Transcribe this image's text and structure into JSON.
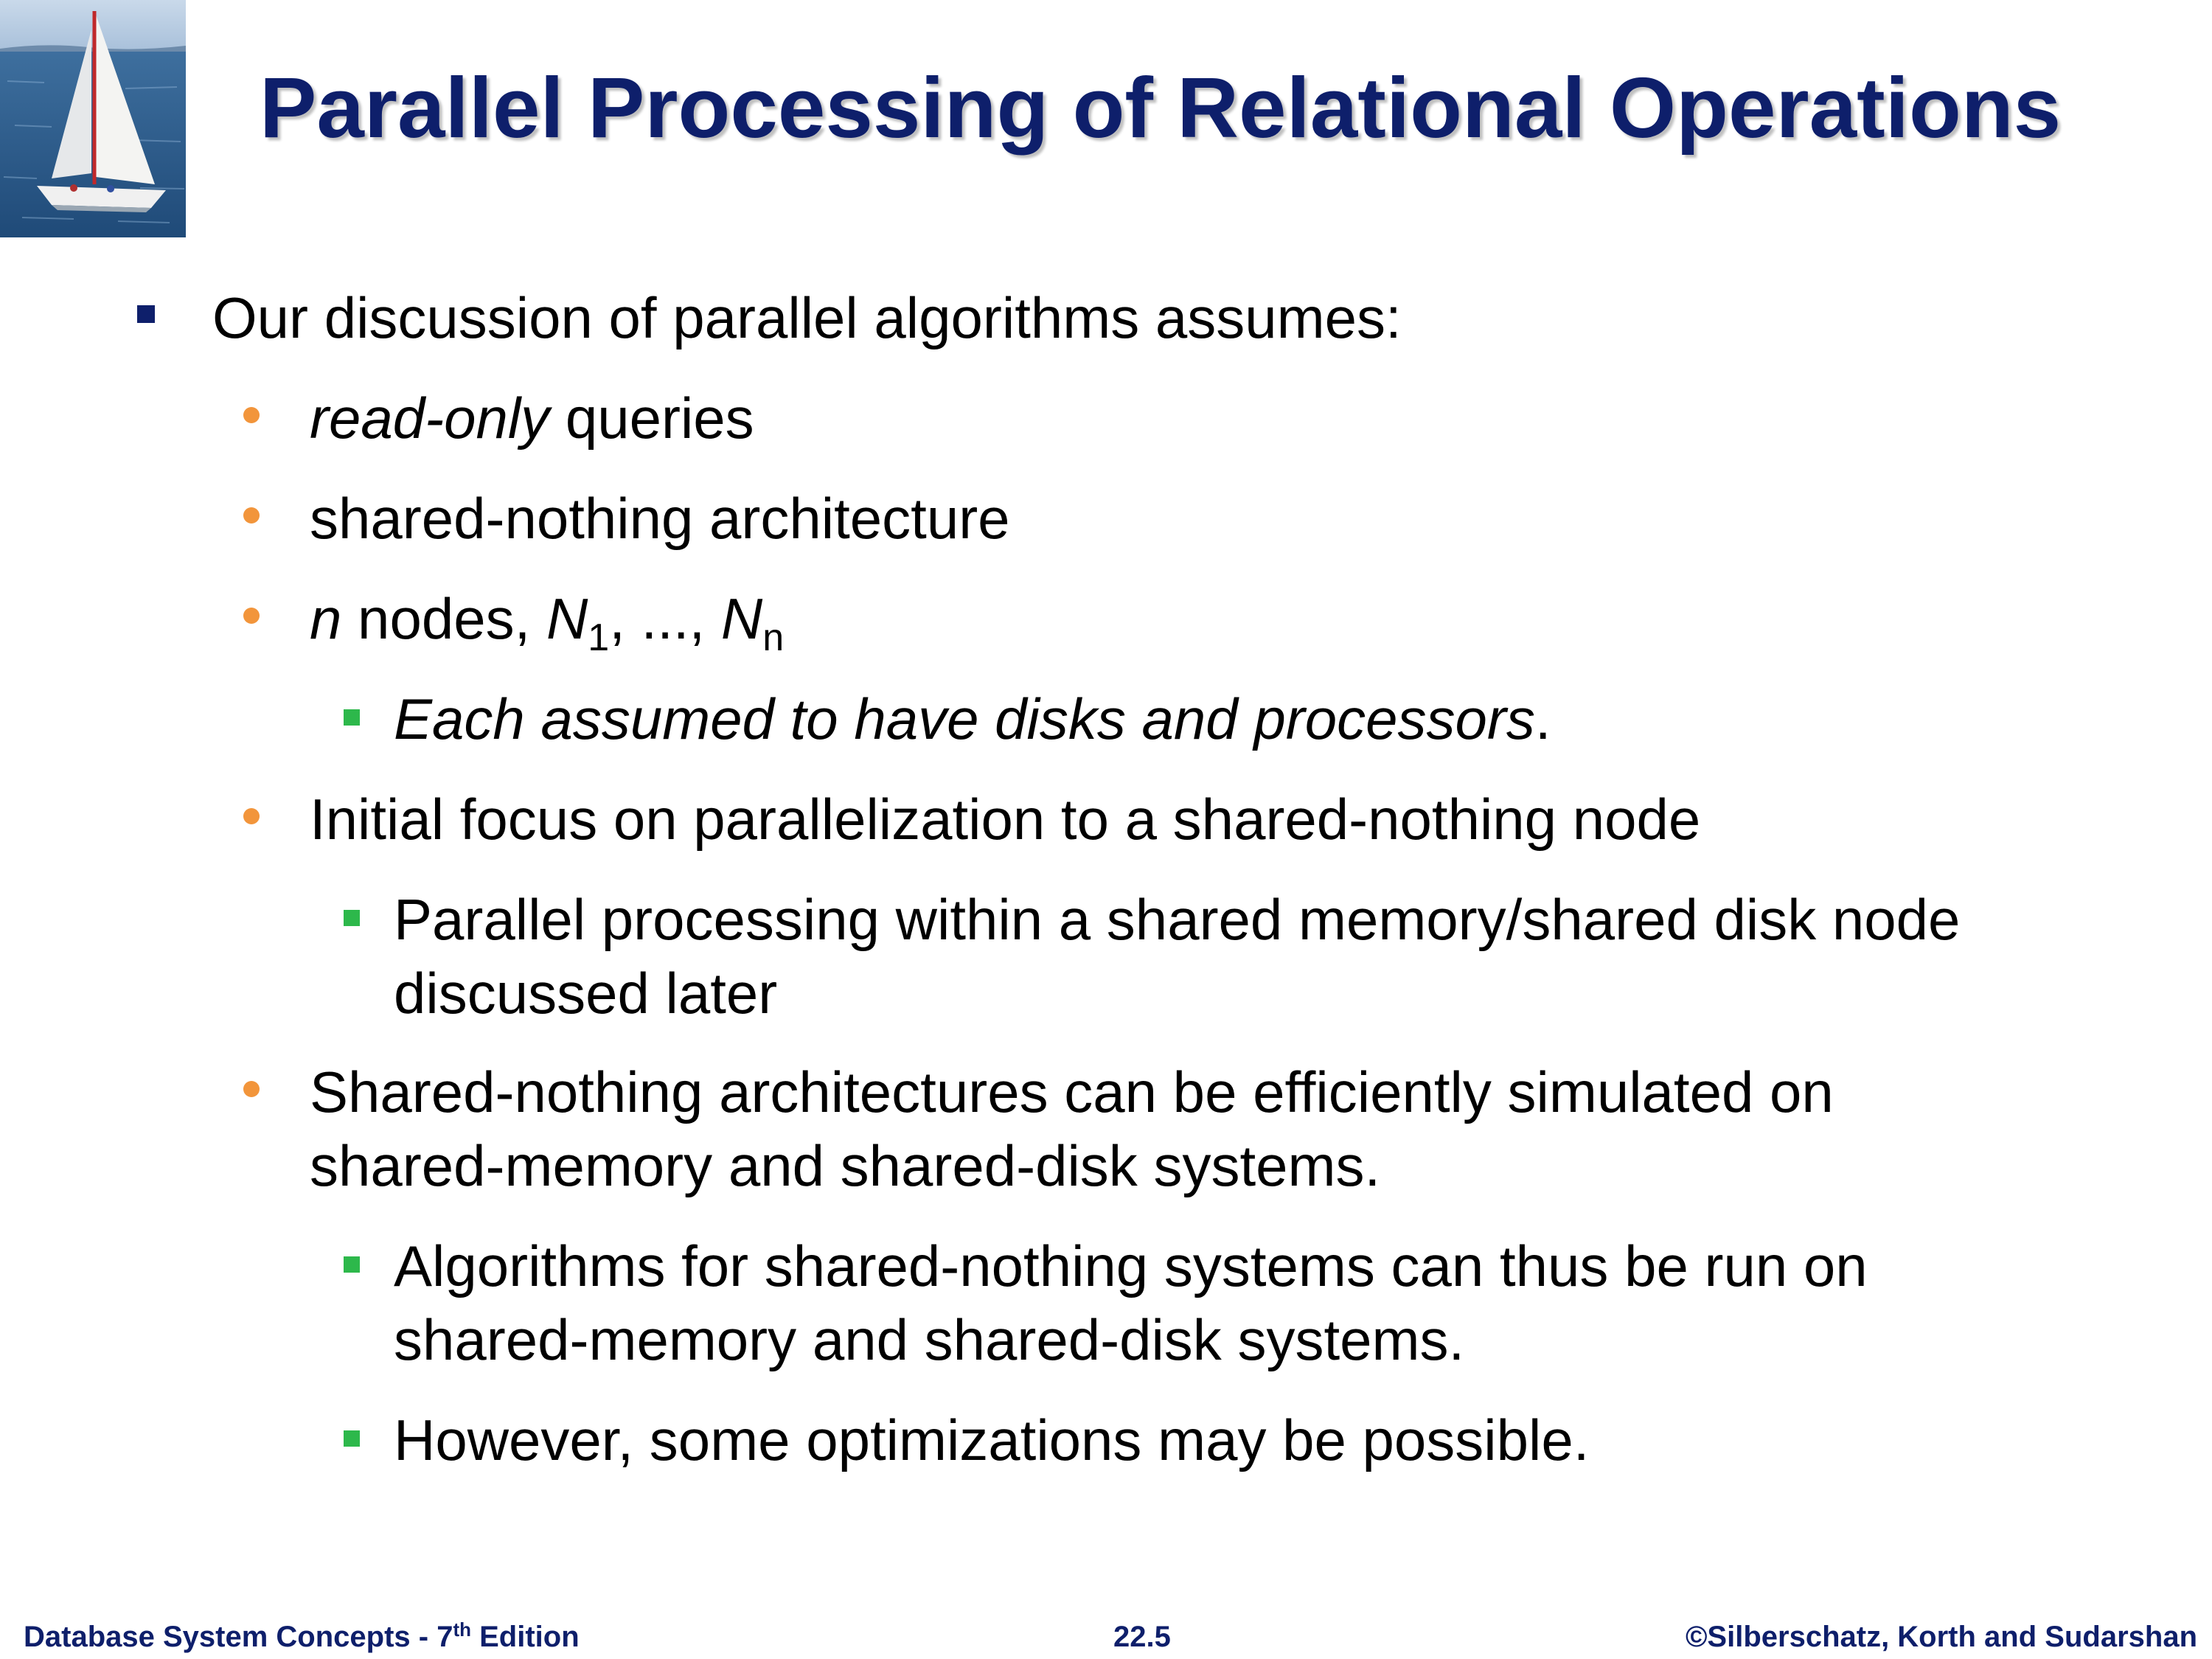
{
  "slide": {
    "title": "Parallel Processing of Relational Operations",
    "logo_icon": "sailboat-photo",
    "colors": {
      "title": "#0e1f6b",
      "bullet_level1": "#0e1f6b",
      "bullet_level2": "#f2953b",
      "bullet_level3": "#2db84b"
    }
  },
  "bullets": {
    "intro": "Our discussion of parallel algorithms assumes:",
    "readonly_italic": "read-only",
    "readonly_rest": " queries",
    "shared_nothing": "shared-nothing architecture",
    "nodes_n": "n",
    "nodes_text": " nodes, ",
    "nodes_N1": "N",
    "nodes_sub1": "1",
    "nodes_ellipsis": ", ..., ",
    "nodes_Nn": "N",
    "nodes_subn": "n",
    "each_italic": "Each assumed to have disks and processors",
    "each_period": ".",
    "initial_focus": "Initial focus on parallelization to a shared-nothing node",
    "parallel_line1": "Parallel processing within a shared memory/shared disk node",
    "parallel_line2": "discussed later",
    "simulated_line1": "Shared-nothing architectures can be efficiently simulated on",
    "simulated_line2": "shared-memory and shared-disk systems.",
    "algorithms_line1": "Algorithms for shared-nothing systems can thus be run on",
    "algorithms_line2": "shared-memory and shared-disk systems.",
    "however": "However, some optimizations may be possible."
  },
  "footer": {
    "book_prefix": "Database System Concepts - 7",
    "book_sup": "th",
    "book_suffix": " Edition",
    "page": "22.5",
    "copyright": "©Silberschatz, Korth and Sudarshan"
  }
}
